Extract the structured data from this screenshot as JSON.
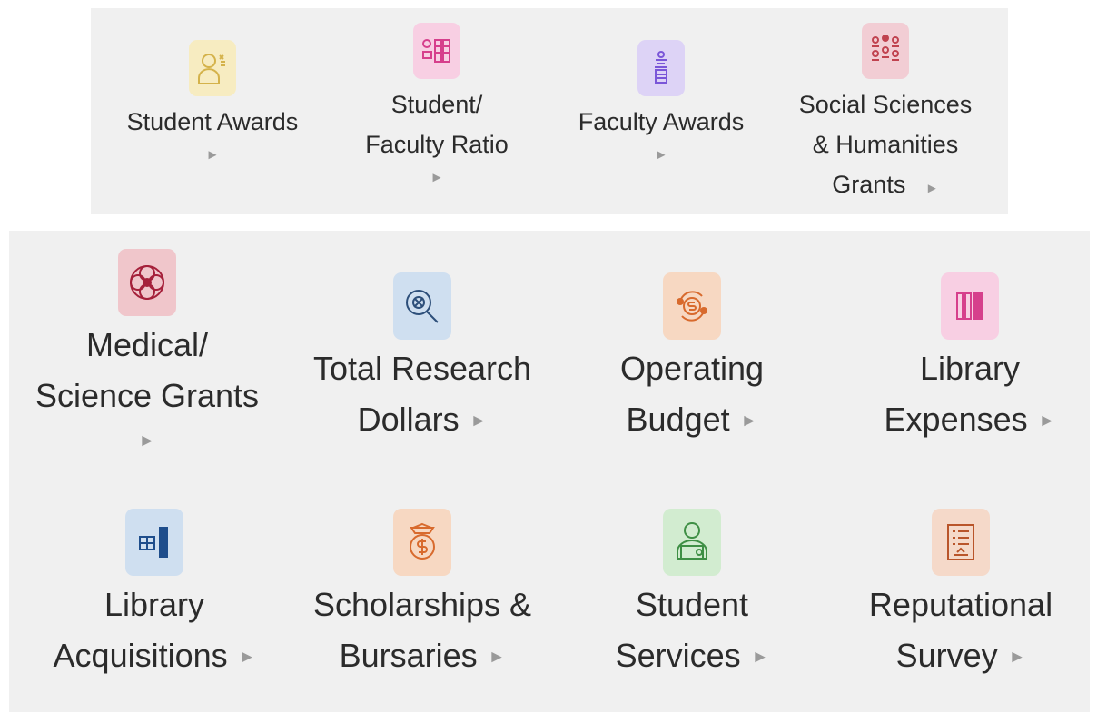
{
  "top_panel": {
    "tiles": [
      {
        "lines": [
          "Student Awards"
        ],
        "icon": "student-awards-icon",
        "icon_bg": "#f7ecc1",
        "icon_color": "#d4b24a"
      },
      {
        "lines": [
          "Student/",
          "Faculty Ratio"
        ],
        "icon": "ratio-icon",
        "icon_bg": "#f8cfe3",
        "icon_color": "#d63f8c"
      },
      {
        "lines": [
          "Faculty Awards"
        ],
        "icon": "faculty-awards-icon",
        "icon_bg": "#ddd3f6",
        "icon_color": "#7a56d8"
      },
      {
        "lines": [
          "Social Sciences",
          "& Humanities",
          "Grants"
        ],
        "icon": "people-network-icon",
        "icon_bg": "#f2cdd4",
        "icon_color": "#c0424f"
      }
    ]
  },
  "bottom_panel": {
    "tiles": [
      {
        "lines": [
          "Medical/",
          "Science Grants"
        ],
        "icon": "molecule-icon",
        "icon_bg": "#f0c6cb",
        "icon_color": "#a5203a"
      },
      {
        "lines": [
          "Total Research",
          "Dollars"
        ],
        "icon": "magnifier-dollar-icon",
        "icon_bg": "#cfdff0",
        "icon_color": "#2d4f7a"
      },
      {
        "lines": [
          "Operating",
          "Budget"
        ],
        "icon": "dollar-cycle-icon",
        "icon_bg": "#f7d8c2",
        "icon_color": "#d86a2d"
      },
      {
        "lines": [
          "Library",
          "Expenses"
        ],
        "icon": "book-shelf-icon",
        "icon_bg": "#f8cfe3",
        "icon_color": "#d63f8c"
      },
      {
        "lines": [
          "Library",
          "Acquisitions"
        ],
        "icon": "book-add-icon",
        "icon_bg": "#cfdff0",
        "icon_color": "#1f4e8c"
      },
      {
        "lines": [
          "Scholarships &",
          "Bursaries"
        ],
        "icon": "money-bag-icon",
        "icon_bg": "#f7d8c2",
        "icon_color": "#d86a2d"
      },
      {
        "lines": [
          "Student",
          "Services"
        ],
        "icon": "student-laptop-icon",
        "icon_bg": "#d2ecd0",
        "icon_color": "#3f8f45"
      },
      {
        "lines": [
          "Reputational",
          "Survey"
        ],
        "icon": "survey-clipboard-icon",
        "icon_bg": "#f5d9c9",
        "icon_color": "#b9552a"
      }
    ]
  },
  "arrow_glyph": "►"
}
